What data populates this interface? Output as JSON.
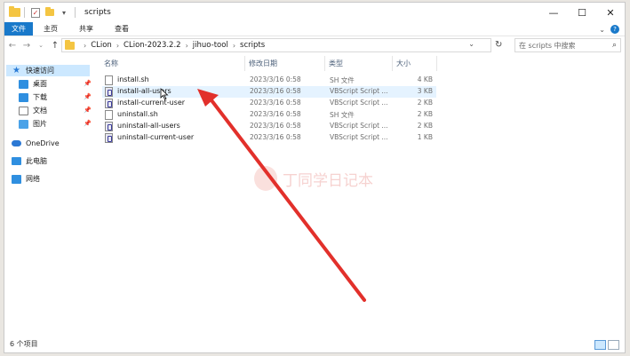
{
  "window": {
    "title": "scripts",
    "controls": {
      "minimize": "—",
      "maximize": "☐",
      "close": "✕"
    }
  },
  "ribbon": {
    "tabs": [
      "文件",
      "主页",
      "共享",
      "查看"
    ],
    "expand_icon": "chevron-down-icon",
    "help_label": "?"
  },
  "address": {
    "crumbs": [
      "CLion",
      "CLion-2023.2.2",
      "jihuo-tool",
      "scripts"
    ],
    "search_placeholder": "在 scripts 中搜索"
  },
  "nav": {
    "quick_access": "快速访问",
    "items": [
      {
        "label": "桌面",
        "icon": "desktop-icon",
        "pinned": true
      },
      {
        "label": "下载",
        "icon": "download-icon",
        "pinned": true
      },
      {
        "label": "文档",
        "icon": "document-icon",
        "pinned": true
      },
      {
        "label": "图片",
        "icon": "pictures-icon",
        "pinned": true
      }
    ],
    "onedrive": "OneDrive",
    "this_pc": "此电脑",
    "network": "网络"
  },
  "columns": {
    "name": "名称",
    "date": "修改日期",
    "type": "类型",
    "size": "大小"
  },
  "files": [
    {
      "name": "install.sh",
      "date": "2023/3/16 0:58",
      "type": "SH 文件",
      "size": "4 KB",
      "icon": "file-icon"
    },
    {
      "name": "install-all-users",
      "date": "2023/3/16 0:58",
      "type": "VBScript Script ...",
      "size": "3 KB",
      "icon": "vbscript-icon"
    },
    {
      "name": "install-current-user",
      "date": "2023/3/16 0:58",
      "type": "VBScript Script ...",
      "size": "2 KB",
      "icon": "vbscript-icon"
    },
    {
      "name": "uninstall.sh",
      "date": "2023/3/16 0:58",
      "type": "SH 文件",
      "size": "2 KB",
      "icon": "file-icon"
    },
    {
      "name": "uninstall-all-users",
      "date": "2023/3/16 0:58",
      "type": "VBScript Script ...",
      "size": "2 KB",
      "icon": "vbscript-icon"
    },
    {
      "name": "uninstall-current-user",
      "date": "2023/3/16 0:58",
      "type": "VBScript Script ...",
      "size": "1 KB",
      "icon": "vbscript-icon"
    }
  ],
  "status": {
    "count": "6 个项目"
  },
  "watermark": {
    "text": "丁同学日记本"
  },
  "colors": {
    "accent": "#1979ca",
    "annotation_arrow": "#e2302b",
    "hover_row": "#e5f3ff"
  }
}
